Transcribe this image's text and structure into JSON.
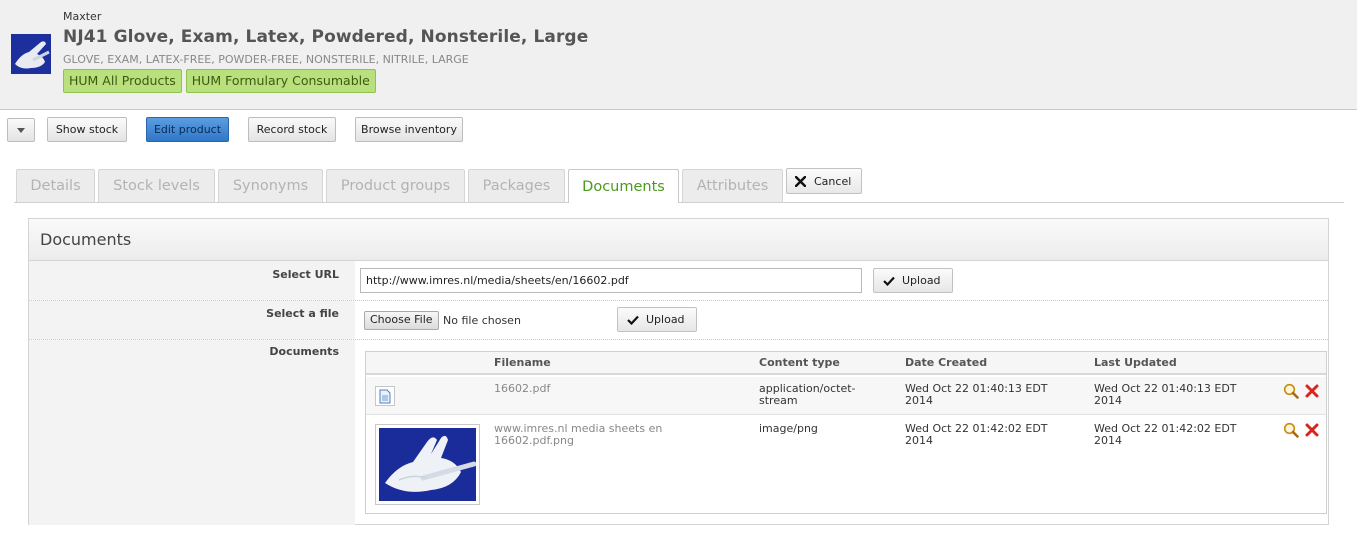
{
  "product": {
    "vendor": "Maxter",
    "title": "NJ41 Glove, Exam, Latex, Powdered, Nonsterile, Large",
    "subtitle": "GLOVE, EXAM, LATEX-FREE, POWDER-FREE, NONSTERILE, NITRILE, LARGE",
    "tags": [
      "HUM All Products",
      "HUM Formulary Consumable"
    ],
    "thumbnail_icon": "glove-photo"
  },
  "toolbar": {
    "dropdown_icon": "chevron-down-icon",
    "show_stock": "Show stock",
    "edit_product": "Edit product",
    "record_stock": "Record stock",
    "browse_inventory": "Browse inventory"
  },
  "tabs": {
    "details": "Details",
    "stock_levels": "Stock levels",
    "synonyms": "Synonyms",
    "product_groups": "Product groups",
    "packages": "Packages",
    "documents": "Documents",
    "attributes": "Attributes",
    "active": "Documents",
    "cancel": "Cancel"
  },
  "panel": {
    "title": "Documents",
    "select_url_label": "Select URL",
    "url_value": "http://www.imres.nl/media/sheets/en/16602.pdf",
    "upload_label": "Upload",
    "select_file_label": "Select a file",
    "choose_file_label": "Choose File",
    "no_file_text": "No file chosen",
    "documents_label": "Documents"
  },
  "documents_table": {
    "headers": {
      "filename": "Filename",
      "content_type": "Content type",
      "date_created": "Date Created",
      "last_updated": "Last Updated"
    },
    "rows": [
      {
        "filename": "16602.pdf",
        "content_type_l1": "application/octet-",
        "content_type_l2": "stream",
        "date_created_l1": "Wed Oct 22 01:40:13 EDT",
        "date_created_l2": "2014",
        "last_updated_l1": "Wed Oct 22 01:40:13 EDT",
        "last_updated_l2": "2014",
        "icon": "document-icon"
      },
      {
        "filename_l1": "www.imres.nl media sheets en",
        "filename_l2": "16602.pdf.png",
        "content_type": "image/png",
        "date_created_l1": "Wed Oct 22 01:42:02 EDT",
        "date_created_l2": "2014",
        "last_updated_l1": "Wed Oct 22 01:42:02 EDT",
        "last_updated_l2": "2014",
        "icon": "glove-image-thumbnail"
      }
    ]
  },
  "colors": {
    "tag_bg": "#b8e07c",
    "primary_button": "#3b82d0",
    "active_tab_text": "#4a9a1c",
    "delete_icon": "#d9261c"
  }
}
